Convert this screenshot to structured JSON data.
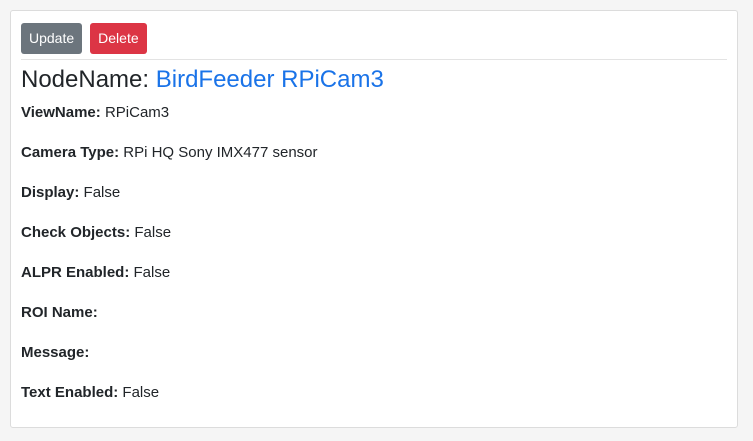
{
  "toolbar": {
    "update_label": "Update",
    "delete_label": "Delete"
  },
  "header": {
    "prefix": "NodeName:",
    "node_name": "BirdFeeder RPiCam3",
    "link_color": "#1a73e8"
  },
  "fields": [
    {
      "label": "ViewName:",
      "value": "RPiCam3"
    },
    {
      "label": "Camera Type:",
      "value": "RPi HQ Sony IMX477 sensor"
    },
    {
      "label": "Display:",
      "value": "False"
    },
    {
      "label": "Check Objects:",
      "value": "False"
    },
    {
      "label": "ALPR Enabled:",
      "value": "False"
    },
    {
      "label": "ROI Name:",
      "value": ""
    },
    {
      "label": "Message:",
      "value": ""
    },
    {
      "label": "Text Enabled:",
      "value": "False"
    }
  ]
}
